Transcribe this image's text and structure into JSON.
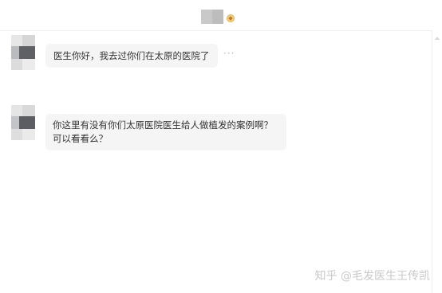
{
  "header": {
    "contact_name": "",
    "badge_icon": "vip-badge-icon"
  },
  "messages": [
    {
      "sender": "user",
      "text": "医生你好，我去过你们在太原的医院了",
      "more_label": "···"
    },
    {
      "sender": "user",
      "text": "你这里有没有你们太原医院医生给人做植发的案例啊？可以看看么？"
    }
  ],
  "watermark": "知乎 @毛发医生王传凯",
  "colors": {
    "bubble_background": "#f5f5f5",
    "divider": "#eeeeee",
    "text": "#333333"
  }
}
